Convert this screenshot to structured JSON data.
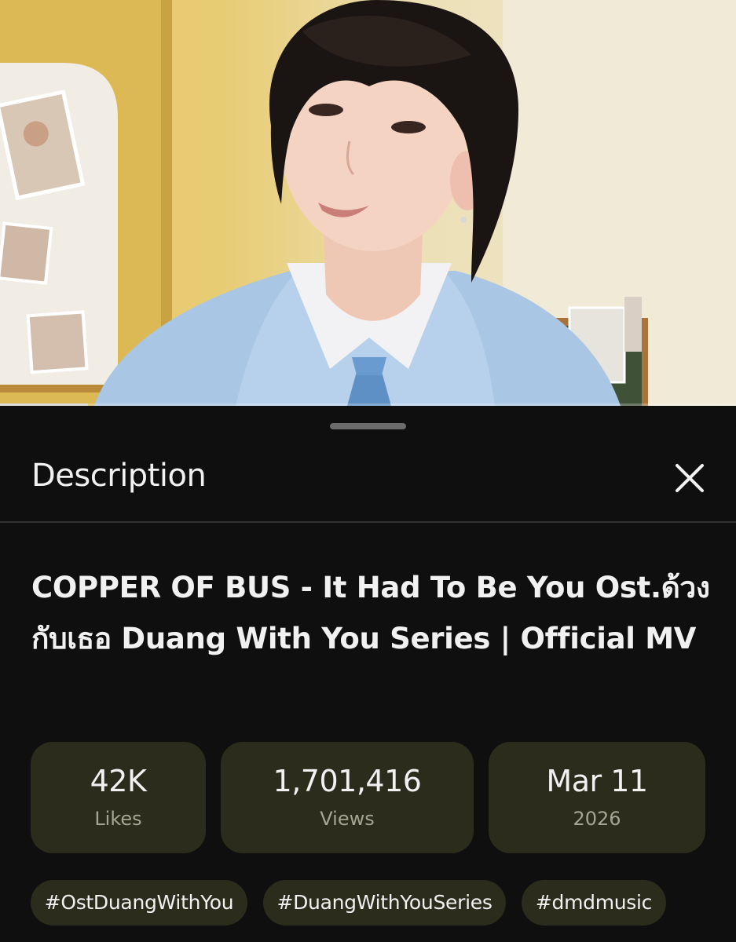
{
  "video": {
    "progress_fraction": 0.12
  },
  "sheet": {
    "title": "Description",
    "close_icon": "close-icon"
  },
  "details": {
    "title": "COPPER OF BUS - It Had To Be You Ost.ด้วงกับเธอ Duang With You Series | Official MV",
    "stats": [
      {
        "value": "42K",
        "label": "Likes"
      },
      {
        "value": "1,701,416",
        "label": "Views"
      },
      {
        "value": "Mar 11",
        "label": "2026"
      }
    ],
    "hashtags": [
      "#OstDuangWithYou",
      "#DuangWithYouSeries",
      "#dmdmusic"
    ]
  },
  "colors": {
    "background": "#0f0f0f",
    "chip_background": "#2c2c1d",
    "text_primary": "#f1f1f1",
    "text_secondary": "#a5a593"
  }
}
